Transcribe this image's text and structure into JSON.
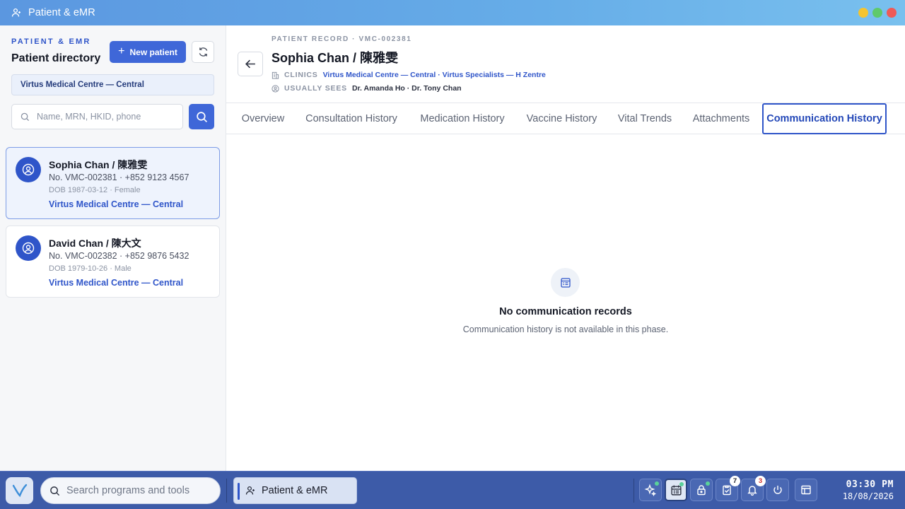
{
  "window": {
    "title": "Patient & eMR",
    "controls": {
      "minimize_color": "#f4c430",
      "maximize_color": "#5fc96b",
      "close_color": "#ef5a57"
    }
  },
  "sidebar": {
    "kicker": "PATIENT & EMR",
    "title": "Patient directory",
    "new_patient_label": "New patient",
    "clinic_filter": "Virtus Medical Centre — Central",
    "search_placeholder": "Name, MRN, HKID, phone",
    "patients": [
      {
        "name": "Sophia Chan / 陳雅雯",
        "contact": "No. VMC-002381 · +852 9123 4567",
        "dob": "DOB 1987-03-12 · Female",
        "clinic": "Virtus Medical Centre — Central",
        "selected": true
      },
      {
        "name": "David Chan / 陳大文",
        "contact": "No. VMC-002382 · +852 9876 5432",
        "dob": "DOB 1979-10-26 · Male",
        "clinic": "Virtus Medical Centre — Central",
        "selected": false
      }
    ]
  },
  "record": {
    "kicker": "PATIENT RECORD · VMC-002381",
    "title": "Sophia Chan / 陳雅雯",
    "clinics_label": "CLINICS",
    "clinics_value": "Virtus Medical Centre — Central · Virtus Specialists — H Zentre",
    "usually_sees_label": "USUALLY SEES",
    "usually_sees_value": "Dr. Amanda Ho · Dr. Tony Chan"
  },
  "tabs": [
    {
      "label": "Overview"
    },
    {
      "label": "Consultation History"
    },
    {
      "label": "Medication History"
    },
    {
      "label": "Vaccine History"
    },
    {
      "label": "Vital Trends"
    },
    {
      "label": "Attachments"
    },
    {
      "label": "Communication History",
      "active": true
    }
  ],
  "empty_state": {
    "icon": "message-list-icon",
    "title": "No communication records",
    "subtitle": "Communication history is not available in this phase."
  },
  "taskbar": {
    "search_placeholder": "Search programs and tools",
    "active_task": "Patient & eMR",
    "tray": [
      {
        "icon": "sparkle-icon",
        "dot": true
      },
      {
        "icon": "calendar-icon",
        "dot": true,
        "active": true
      },
      {
        "icon": "lock-icon",
        "dot": true
      },
      {
        "icon": "clipboard-check-icon",
        "badge": "7"
      },
      {
        "icon": "bell-icon",
        "badge": "3"
      },
      {
        "icon": "power-icon"
      },
      {
        "icon": "layout-icon"
      }
    ],
    "clock": {
      "time": "03:30 PM",
      "date": "18/08/2026"
    }
  },
  "colors": {
    "accent": "#2f55c9",
    "taskbar": "#3d5ba8"
  }
}
